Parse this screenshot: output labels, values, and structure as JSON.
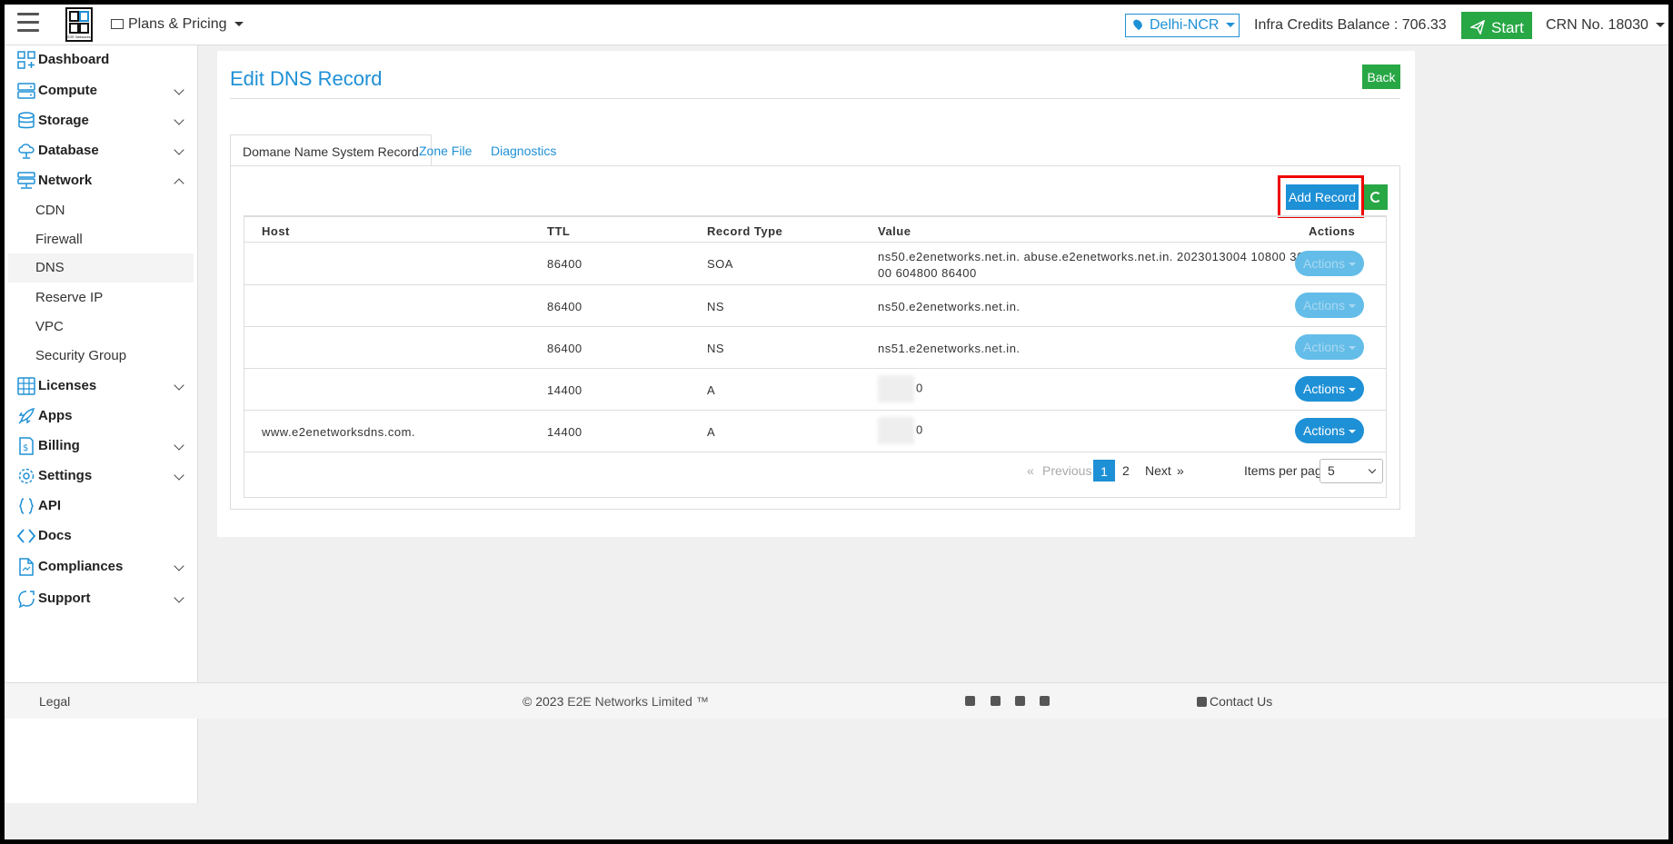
{
  "topbar": {
    "menu_icon": "hamburger-icon",
    "logo_caption": "E2E Networks",
    "plans_label": "Plans & Pricing",
    "region": "Delhi-NCR",
    "credits": "Infra Credits Balance : 706.33",
    "start_label": "Start",
    "crn": "CRN No. 18030"
  },
  "sidebar": {
    "dashboard": "Dashboard",
    "compute": "Compute",
    "storage": "Storage",
    "database": "Database",
    "network": "Network",
    "network_sub": [
      "CDN",
      "Firewall",
      "DNS",
      "Reserve IP",
      "VPC",
      "Security Group"
    ],
    "licenses": "Licenses",
    "apps": "Apps",
    "billing": "Billing",
    "settings": "Settings",
    "api": "API",
    "docs": "Docs",
    "compliances": "Compliances",
    "support": "Support"
  },
  "main": {
    "title": "Edit DNS Record",
    "back_label": "Back",
    "tabs": [
      {
        "label": "Domane Name System Record"
      },
      {
        "label": "Zone File"
      },
      {
        "label": "Diagnostics"
      }
    ],
    "add_record_label": "Add Record",
    "table": {
      "headers": [
        "Host",
        "TTL",
        "Record Type",
        "Value",
        "Actions"
      ],
      "rows": [
        {
          "host": "",
          "ttl": "86400",
          "type": "SOA",
          "value_line1": "ns50.e2enetworks.net.in. abuse.e2enetworks.net.in. 2023013004 10800 36",
          "value_line2": "00 604800 86400",
          "action": "Actions"
        },
        {
          "host": "",
          "ttl": "86400",
          "type": "NS",
          "value": "ns50.e2enetworks.net.in.",
          "action": "Actions"
        },
        {
          "host": "",
          "ttl": "86400",
          "type": "NS",
          "value": "ns51.e2enetworks.net.in.",
          "action": "Actions"
        },
        {
          "host": "",
          "ttl": "14400",
          "type": "A",
          "value": "0",
          "action": "Actions"
        },
        {
          "host": "www.e2enetworksdns.com.",
          "ttl": "14400",
          "type": "A",
          "value": "0",
          "action": "Actions"
        }
      ]
    },
    "pagination": {
      "prev_arrow": "«",
      "previous": "Previous",
      "page1": "1",
      "page2": "2",
      "next": "Next",
      "next_arrow": "»",
      "items_per_page_label": "Items per page",
      "items_per_page_value": "5"
    }
  },
  "footer": {
    "legal": "Legal",
    "copyright_prefix": "© 2023",
    "brand": "E2E Networks Limited ™",
    "contact": "Contact Us"
  },
  "colors": {
    "primary": "#1e90d6",
    "success": "#28a745",
    "highlight": "#e00000"
  }
}
